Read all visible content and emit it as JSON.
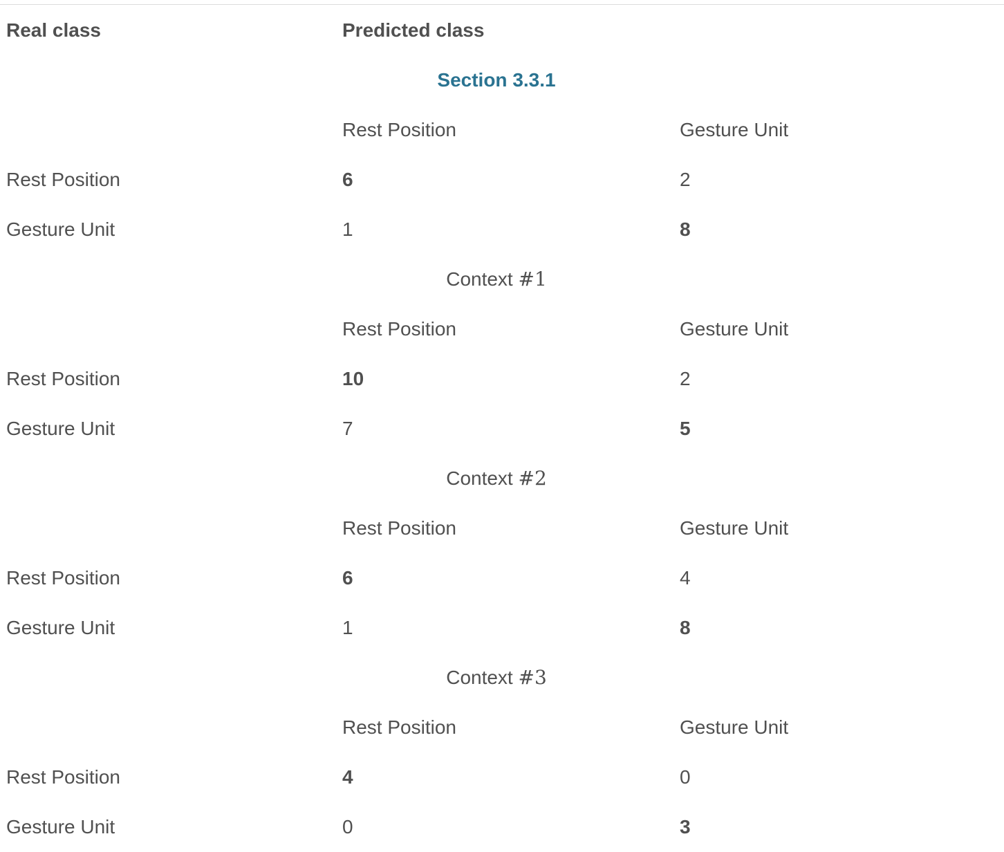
{
  "header": {
    "real_class": "Real class",
    "predicted_class": "Predicted class"
  },
  "blocks": [
    {
      "title_text": "",
      "title_link": "Section 3.3.1",
      "title_num": "",
      "col_headers": [
        "Rest Position",
        "Gesture Unit"
      ],
      "rows": [
        {
          "label": "Rest Position",
          "values": [
            "6",
            "2"
          ],
          "bold_index": 0
        },
        {
          "label": "Gesture Unit",
          "values": [
            "1",
            "8"
          ],
          "bold_index": 1
        }
      ]
    },
    {
      "title_text": "Context ",
      "title_link": "",
      "title_num": "#1",
      "col_headers": [
        "Rest Position",
        "Gesture Unit"
      ],
      "rows": [
        {
          "label": "Rest Position",
          "values": [
            "10",
            "2"
          ],
          "bold_index": 0
        },
        {
          "label": "Gesture Unit",
          "values": [
            "7",
            "5"
          ],
          "bold_index": 1
        }
      ]
    },
    {
      "title_text": "Context ",
      "title_link": "",
      "title_num": "#2",
      "col_headers": [
        "Rest Position",
        "Gesture Unit"
      ],
      "rows": [
        {
          "label": "Rest Position",
          "values": [
            "6",
            "4"
          ],
          "bold_index": 0
        },
        {
          "label": "Gesture Unit",
          "values": [
            "1",
            "8"
          ],
          "bold_index": 1
        }
      ]
    },
    {
      "title_text": "Context ",
      "title_link": "",
      "title_num": "#3",
      "col_headers": [
        "Rest Position",
        "Gesture Unit"
      ],
      "rows": [
        {
          "label": "Rest Position",
          "values": [
            "4",
            "0"
          ],
          "bold_index": 0
        },
        {
          "label": "Gesture Unit",
          "values": [
            "0",
            "3"
          ],
          "bold_index": 1
        }
      ]
    }
  ]
}
